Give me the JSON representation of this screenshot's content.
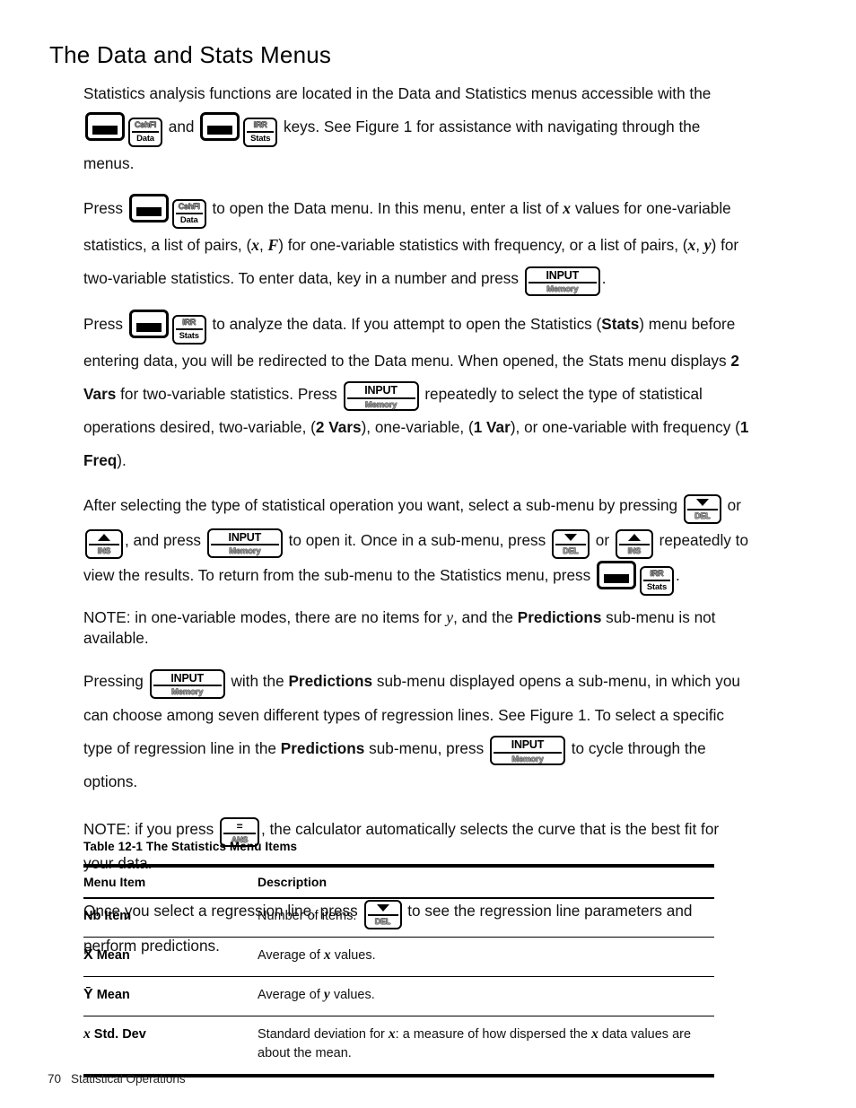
{
  "document": {
    "heading": "The Data and Stats Menus"
  },
  "keys": {
    "shift": {
      "name": "shift-key",
      "label": ""
    },
    "cshfl_data": {
      "top": "CshFl",
      "bottom": "Data"
    },
    "irr_stats": {
      "top": "IRR",
      "bottom": "Stats"
    },
    "input_memory": {
      "top": "INPUT",
      "bottom": "Memory"
    },
    "down_del": {
      "top": "▼",
      "bottom": "DEL"
    },
    "up_ins": {
      "top": "▲",
      "bottom": "INS"
    },
    "eq_ans": {
      "top": "=",
      "bottom": "ANS"
    }
  },
  "paragraphs": {
    "p1": {
      "s1": "Statistics analysis functions are located in the Data and Statistics menus accessible with the",
      "s2": "and",
      "s3": "keys. See Figure 1 for assistance with navigating through the menus."
    },
    "p2": {
      "s1": "Press",
      "s2": "to open the Data menu. In this menu, enter a list of",
      "x1": "x",
      "s3": "values for one-variable statistics, a list of pairs, (",
      "x2": "x",
      "s4": ",",
      "f1": "F",
      "s5": ") for one-variable statistics with frequency, or a list of pairs, (",
      "x3": "x",
      "s6": ",",
      "y1": "y",
      "s7": ") for two-variable statistics. To enter data, key in a number and press",
      "s8": "."
    },
    "p3": {
      "s1": "Press",
      "s2": "to analyze the data. If you attempt to open the Statistics (",
      "b1": "Stats",
      "s3": ") menu before entering data, you will be redirected to the Data menu. When opened, the Stats menu displays",
      "b2": "2 Vars",
      "s4": "for two-variable statistics. Press",
      "s5": "repeatedly to select the type of statistical operations desired, two-variable, (",
      "b3": "2 Vars",
      "s6": "), one-variable, (",
      "b4": "1 Var",
      "s7": "), or one-variable with frequency (",
      "b5": "1 Freq",
      "s8": ")."
    },
    "p4": {
      "s1": "After selecting the type of statistical operation you want, select a sub-menu by pressing",
      "s2": "or",
      "s3": ", and press",
      "s4": "to open it. Once in a sub-menu, press",
      "s5": "or",
      "s6": "repeatedly to view the results. To return from the sub-menu to the Statistics menu, press",
      "s7": "."
    },
    "p5": {
      "s1": "NOTE:  in one-variable modes, there are no items for",
      "y1": "y",
      "s2": ", and the",
      "b1": "Predictions",
      "s3": "sub-menu is not available."
    },
    "p6": {
      "s1": "Pressing",
      "s2": "with the",
      "b1": "Predictions",
      "s3": "sub-menu displayed opens a sub-menu, in which you can choose among seven different types of regression lines. See Figure 1. To select a specific type of regression line in the",
      "b2": "Predictions",
      "s4": "sub-menu, press",
      "s5": "to cycle through the options."
    },
    "p7": {
      "s1": "NOTE:  if you press",
      "s2": ", the calculator automatically selects the curve that is the best fit for your data."
    },
    "p8": {
      "s1": "Once you select a regression line, press",
      "s2": "to see the regression line parameters and perform predictions."
    }
  },
  "table": {
    "caption": "Table 12-1  The Statistics Menu Items",
    "headers": [
      "Menu Item",
      "Description"
    ],
    "rows": [
      {
        "item": "Nb Item",
        "item_prefix": "",
        "desc_pre": "Number of items.",
        "desc_var": "",
        "desc_post": ""
      },
      {
        "item": "Mean",
        "item_prefix": "X̄",
        "desc_pre": "Average of",
        "desc_var": "x",
        "desc_post": "values."
      },
      {
        "item": "Mean",
        "item_prefix": "Ȳ",
        "desc_pre": "Average of",
        "desc_var": "y",
        "desc_post": "values."
      },
      {
        "item": "Std. Dev",
        "item_prefix": "x",
        "desc_pre": "Standard deviation for",
        "desc_var": "x",
        "desc_post": ": a measure of how dispersed the",
        "desc_var2": "x",
        "desc_post2": "data values are about the mean."
      }
    ]
  },
  "footer": {
    "page_number": "70",
    "section": "Statistical Operations"
  }
}
